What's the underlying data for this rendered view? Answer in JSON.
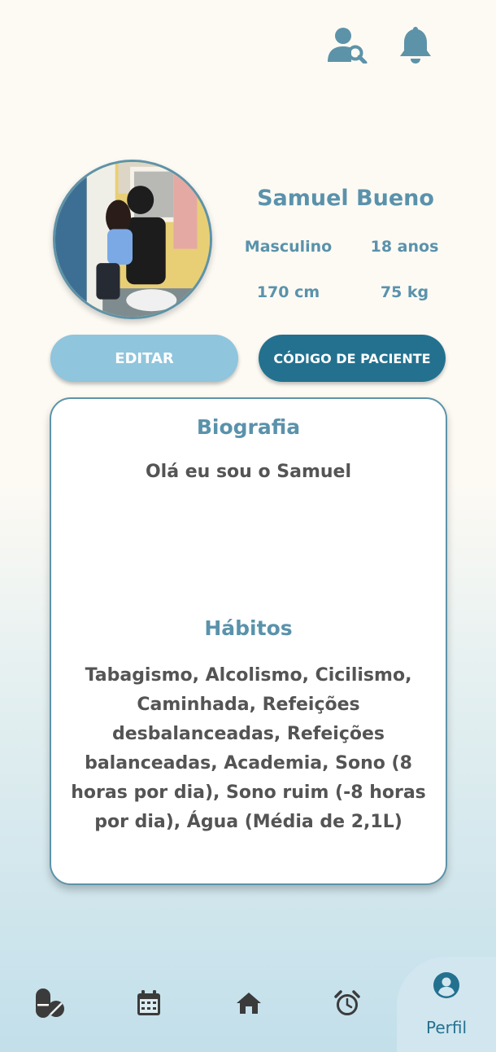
{
  "header": {
    "icons": [
      "search-user-icon",
      "bell-icon"
    ]
  },
  "profile": {
    "name": "Samuel Bueno",
    "gender": "Masculino",
    "age": "18 anos",
    "height": "170 cm",
    "weight": "75 kg"
  },
  "actions": {
    "edit_label": "EDITAR",
    "patient_code_label": "CÓDIGO DE PACIENTE"
  },
  "card": {
    "bio_title": "Biografia",
    "bio_text": "Olá eu sou o Samuel",
    "habits_title": "Hábitos",
    "habits_text": "Tabagismo, Alcolismo, Cicilismo, Caminhada, Refeições desbalanceadas, Refeições balanceadas, Academia, Sono (8 horas por dia), Sono ruim (-8 horas por dia), Água (Média de 2,1L)"
  },
  "nav": {
    "items": [
      {
        "icon": "pills-icon"
      },
      {
        "icon": "calendar-icon"
      },
      {
        "icon": "home-icon"
      },
      {
        "icon": "alarm-clock-icon"
      },
      {
        "icon": "user-icon",
        "label": "Perfil",
        "active": true
      }
    ]
  },
  "colors": {
    "accent": "#5a92ab",
    "primary_dark": "#23718f",
    "primary_light": "#8fc5dd",
    "text": "#545454",
    "nav_icon": "#3b3b3b"
  }
}
